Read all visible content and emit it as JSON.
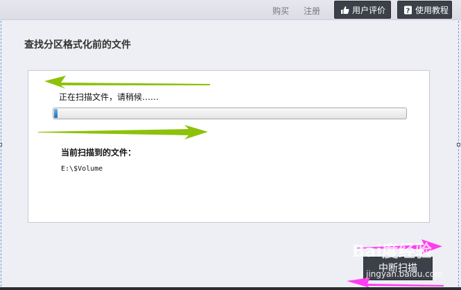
{
  "header": {
    "link_buy": "购买",
    "link_register": "注册",
    "btn_reviews": "用户评价",
    "btn_tutorial": "使用教程"
  },
  "page": {
    "title": "查找分区格式化前的文件"
  },
  "scan": {
    "status": "正在扫描文件，请稍候……",
    "progress_percent": 1,
    "current_file_label": "当前扫描到的文件：",
    "current_file": "E:\\$Volume"
  },
  "actions": {
    "stop_label": "中断扫描"
  },
  "watermark": {
    "text": "Bai度经验",
    "url": "jingyan.baidu.com"
  },
  "colors": {
    "annotation_green": "#8cc20a",
    "annotation_magenta": "#ff3cf0",
    "button_dark": "#3c4049"
  }
}
